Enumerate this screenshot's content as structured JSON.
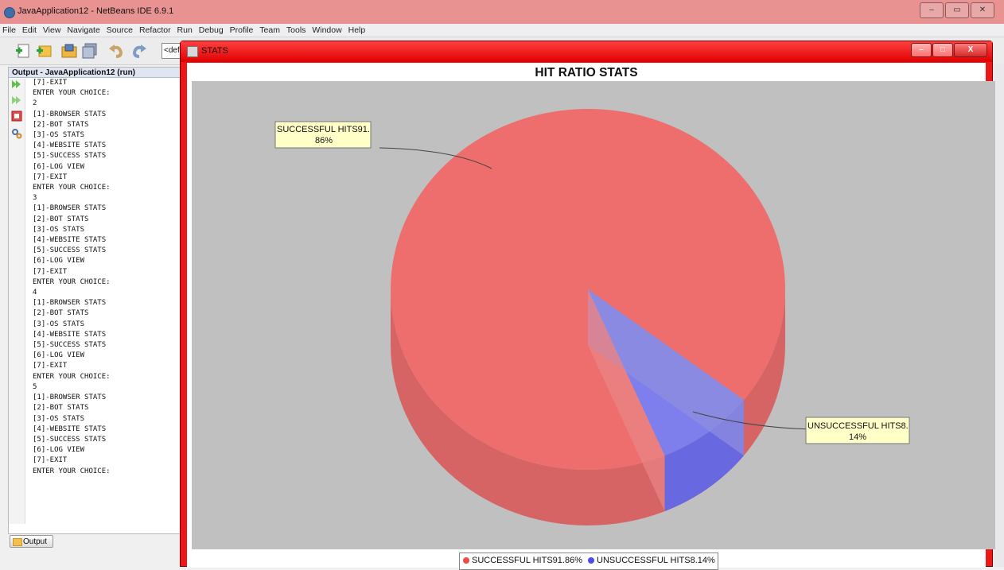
{
  "ide": {
    "title": "JavaApplication12 - NetBeans IDE 6.9.1",
    "window_controls": [
      "–",
      "▭",
      "✕"
    ],
    "menu": [
      "File",
      "Edit",
      "View",
      "Navigate",
      "Source",
      "Refactor",
      "Run",
      "Debug",
      "Profile",
      "Team",
      "Tools",
      "Window",
      "Help"
    ],
    "config_value": "<def"
  },
  "output": {
    "title": "Output - JavaApplication12 (run)",
    "lines": [
      "[7]-EXIT",
      "ENTER YOUR CHOICE:",
      "2",
      "[1]-BROWSER STATS",
      "[2]-BOT STATS",
      "[3]-OS STATS",
      "[4]-WEBSITE STATS",
      "[5]-SUCCESS STATS",
      "[6]-LOG VIEW",
      "[7]-EXIT",
      "ENTER YOUR CHOICE:",
      "3",
      "[1]-BROWSER STATS",
      "[2]-BOT STATS",
      "[3]-OS STATS",
      "[4]-WEBSITE STATS",
      "[5]-SUCCESS STATS",
      "[6]-LOG VIEW",
      "[7]-EXIT",
      "ENTER YOUR CHOICE:",
      "4",
      "[1]-BROWSER STATS",
      "[2]-BOT STATS",
      "[3]-OS STATS",
      "[4]-WEBSITE STATS",
      "[5]-SUCCESS STATS",
      "[6]-LOG VIEW",
      "[7]-EXIT",
      "ENTER YOUR CHOICE:",
      "5",
      "[1]-BROWSER STATS",
      "[2]-BOT STATS",
      "[3]-OS STATS",
      "[4]-WEBSITE STATS",
      "[5]-SUCCESS STATS",
      "[6]-LOG VIEW",
      "[7]-EXIT",
      "ENTER YOUR CHOICE:"
    ],
    "tab_label": "Output"
  },
  "stats_window": {
    "title": "STATS",
    "controls": [
      "–",
      "□",
      "X"
    ]
  },
  "chart_data": {
    "type": "pie",
    "title": "HIT RATIO STATS",
    "slices": [
      {
        "label": "SUCCESSFUL HITS",
        "value": 91.86,
        "callout_line1": "SUCCESSFUL HITS91.",
        "callout_line2": "86%",
        "legend": "SUCCESSFUL HITS91.86%",
        "color": "#ee6e6e"
      },
      {
        "label": "UNSUCCESSFUL HITS",
        "value": 8.14,
        "callout_line1": "UNSUCCESSFUL HITS8.",
        "callout_line2": "14%",
        "legend": "UNSUCCESSFUL HITS8.14%",
        "color": "#7575f0"
      }
    ],
    "style": "3d",
    "legend_position": "bottom",
    "plot_background": "#c0c0c0"
  }
}
